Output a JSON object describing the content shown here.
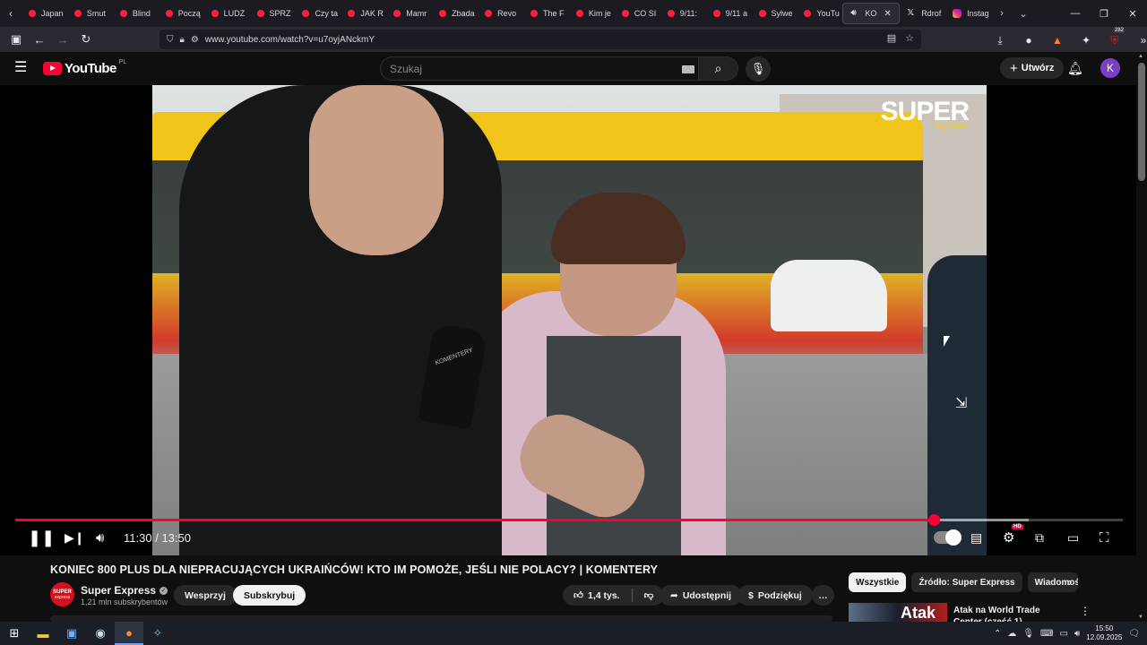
{
  "browser": {
    "tabs": [
      {
        "label": "Japan",
        "icon": "youtube-icon"
      },
      {
        "label": "Smut",
        "icon": "youtube-icon"
      },
      {
        "label": "Blind",
        "icon": "youtube-icon"
      },
      {
        "label": "Począ",
        "icon": "youtube-icon"
      },
      {
        "label": "LUDZ",
        "icon": "youtube-icon"
      },
      {
        "label": "SPRZ",
        "icon": "youtube-icon"
      },
      {
        "label": "Czy ta",
        "icon": "youtube-icon"
      },
      {
        "label": "JAK R",
        "icon": "youtube-icon"
      },
      {
        "label": "Mamr",
        "icon": "youtube-icon"
      },
      {
        "label": "Zbada",
        "icon": "youtube-icon"
      },
      {
        "label": "Revo",
        "icon": "youtube-icon"
      },
      {
        "label": "The F",
        "icon": "youtube-icon"
      },
      {
        "label": "Kim je",
        "icon": "youtube-icon"
      },
      {
        "label": "CO SI",
        "icon": "youtube-icon"
      },
      {
        "label": "9/11:",
        "icon": "youtube-icon"
      },
      {
        "label": "9/11 a",
        "icon": "youtube-icon"
      },
      {
        "label": "Sylwe",
        "icon": "youtube-icon"
      },
      {
        "label": "YouTu",
        "icon": "youtube-icon"
      },
      {
        "label": "KO",
        "icon": "speaker-icon",
        "active": true
      },
      {
        "label": "Rdrof",
        "icon": "x-icon"
      },
      {
        "label": "Instag",
        "icon": "instagram-icon"
      }
    ],
    "url": "www.youtube.com/watch?v=u7oyjANckmY",
    "extension_badge": "282",
    "accent": "#ff0033"
  },
  "youtube": {
    "logo_text": "YouTube",
    "region": "PL",
    "search_placeholder": "Szukaj",
    "create_label": "Utwórz",
    "avatar_letter": "K",
    "avatar_color": "#7b3fc4"
  },
  "video": {
    "watermark_big": "SUPER",
    "watermark_small": "express",
    "mic_label": "KOMENTERY",
    "time_current": "11:30",
    "time_separator": "/",
    "time_total": "13:50",
    "played_fraction": 0.829,
    "buffered_fraction": 0.915,
    "hd_badge": "HD"
  },
  "details": {
    "title": "KONIEC 800 PLUS DLA NIEPRACUJĄCYCH UKRAIŃCÓW! KTO IM POMOŻE, JEŚLI NIE POLACY? | KOMENTERY",
    "channel_name": "Super Express",
    "channel_avatar_line1": "SUPER",
    "channel_avatar_line2": "express",
    "subscribers": "1,21 mln subskrybentów",
    "support_label": "Wesprzyj",
    "subscribe_label": "Subskrybuj",
    "likes": "1,4 tys.",
    "share_label": "Udostępnij",
    "thanks_label": "Podziękuj",
    "more_label": "…"
  },
  "sidebar": {
    "chips": [
      "Wszystkie",
      "Źródło: Super Express",
      "Wiadomości"
    ],
    "rec_thumb_text": "Atak",
    "rec_title": "Atak na World Trade Center (część 1)"
  },
  "taskbar": {
    "time": "15:50",
    "date": "12.09.2025"
  }
}
